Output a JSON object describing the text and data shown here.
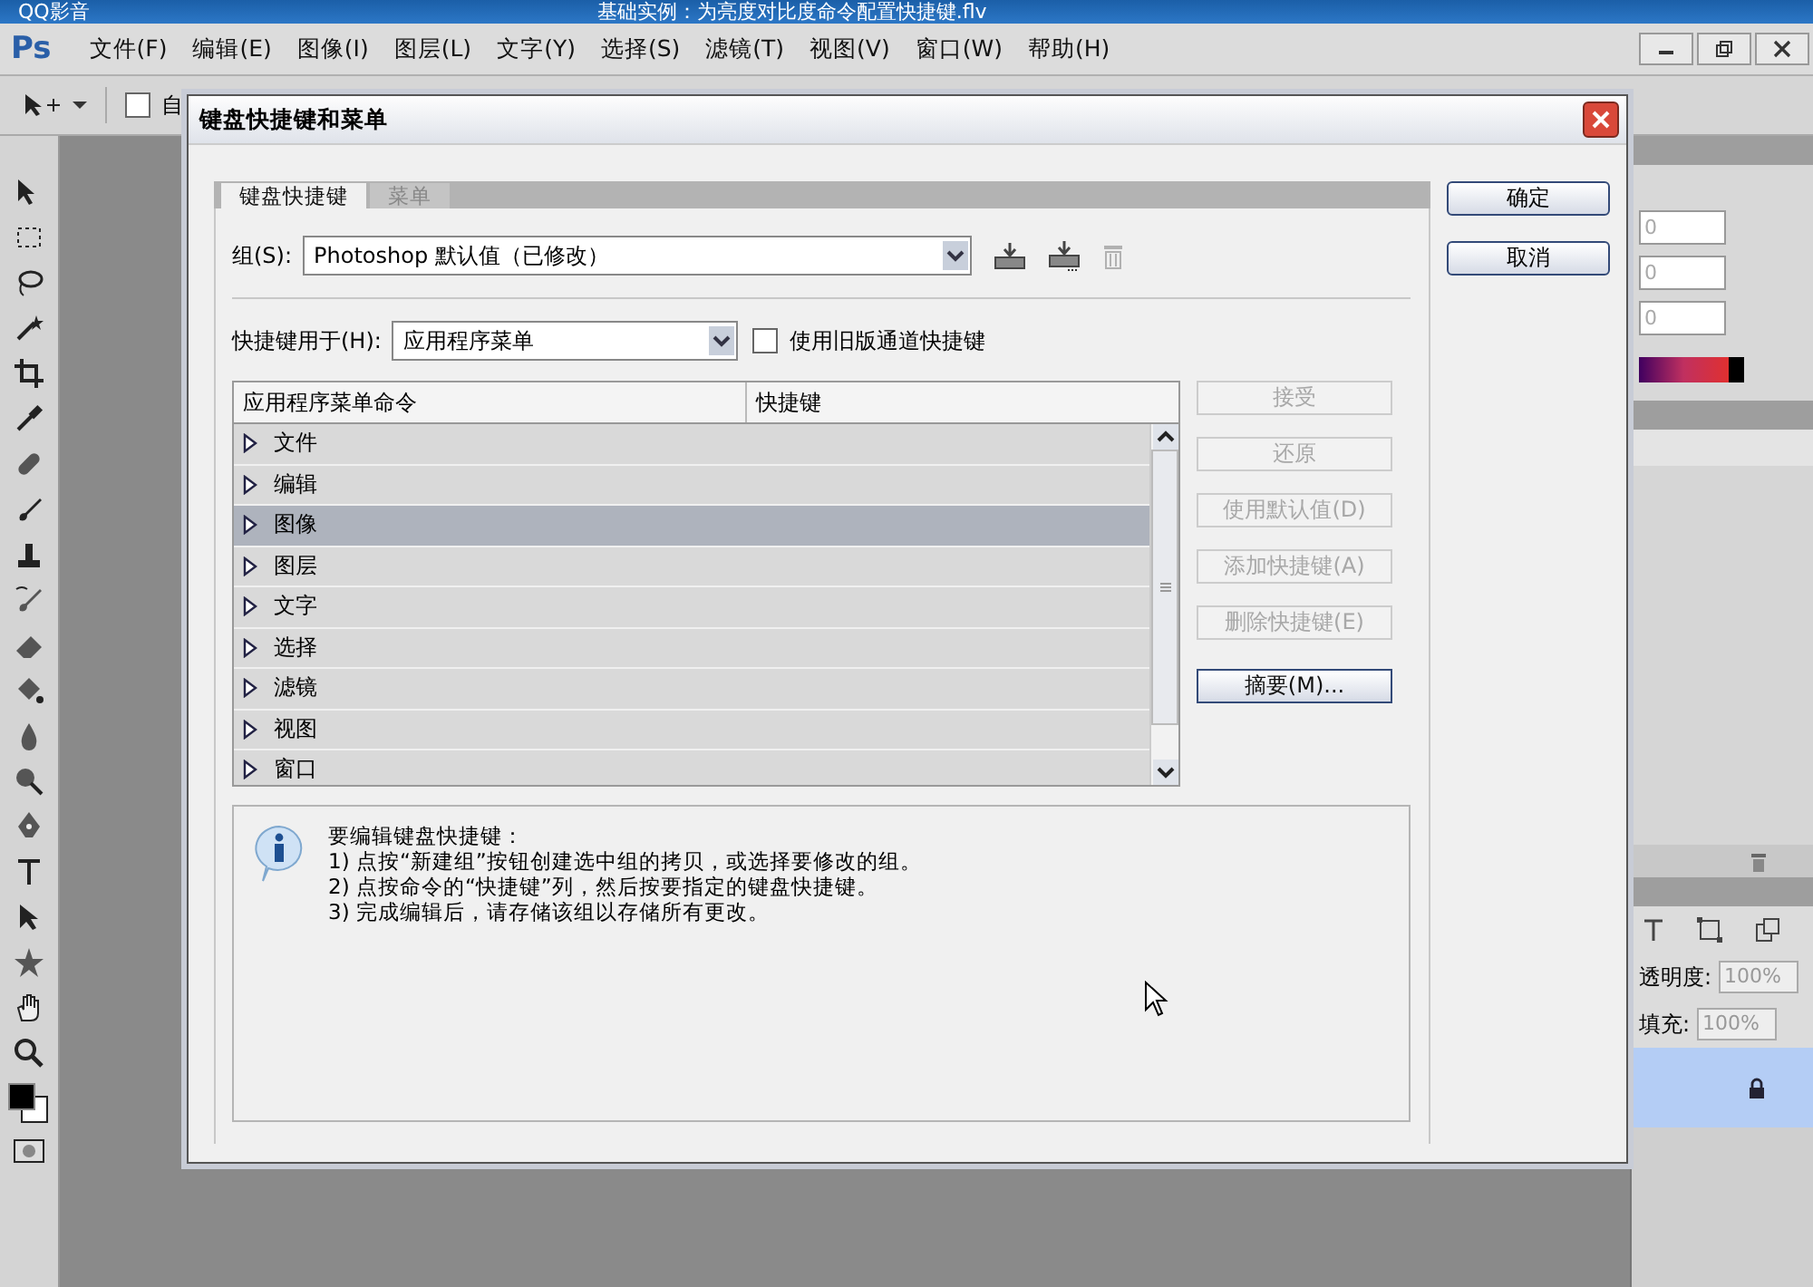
{
  "player_title_bar": {
    "app_name": "QQ影音",
    "video_title": "基础实例：为亮度对比度命令配置快捷键.flv"
  },
  "menu_bar": {
    "logo": "Ps",
    "items": [
      "文件(F)",
      "编辑(E)",
      "图像(I)",
      "图层(L)",
      "文字(Y)",
      "选择(S)",
      "滤镜(T)",
      "视图(V)",
      "窗口(W)",
      "帮助(H)"
    ]
  },
  "options_bar": {
    "checkbox_label": "自",
    "checked": false
  },
  "dialog": {
    "title": "键盘快捷键和菜单",
    "tabs": [
      {
        "label": "键盘快捷键",
        "selected": true
      },
      {
        "label": "菜单",
        "selected": false
      }
    ],
    "set_label": "组(S):",
    "set_value": "Photoshop 默认值（已修改）",
    "delete_disabled": true,
    "shortcuts_for_label": "快捷键用于(H):",
    "shortcuts_for_value": "应用程序菜单",
    "legacy_checkbox": {
      "label": "使用旧版通道快捷键",
      "checked": false
    },
    "table": {
      "columns": [
        "应用程序菜单命令",
        "快捷键"
      ],
      "rows": [
        {
          "label": "文件",
          "selected": false
        },
        {
          "label": "编辑",
          "selected": false
        },
        {
          "label": "图像",
          "selected": true
        },
        {
          "label": "图层",
          "selected": false
        },
        {
          "label": "文字",
          "selected": false
        },
        {
          "label": "选择",
          "selected": false
        },
        {
          "label": "滤镜",
          "selected": false
        },
        {
          "label": "视图",
          "selected": false
        },
        {
          "label": "窗口",
          "selected": false
        }
      ]
    },
    "side_buttons": [
      {
        "label": "接受",
        "disabled": true
      },
      {
        "label": "还原",
        "disabled": true
      },
      {
        "label": "使用默认值(D)",
        "disabled": true
      },
      {
        "label": "添加快捷键(A)",
        "disabled": true
      },
      {
        "label": "删除快捷键(E)",
        "disabled": true
      },
      {
        "label": "摘要(M)...",
        "disabled": false
      }
    ],
    "info_lines": [
      "要编辑键盘快捷键：",
      "1) 点按“新建组”按钮创建选中组的拷贝，或选择要修改的组。",
      "2) 点按命令的“快捷键”列，然后按要指定的键盘快捷键。",
      "3) 完成编辑后，请存储该组以存储所有更改。"
    ],
    "buttons": [
      "确定",
      "取消"
    ]
  },
  "right_panel": {
    "color_values": [
      "0",
      "0",
      "0"
    ],
    "opacity_label": "透明度:",
    "opacity_value": "100%",
    "fill_label": "填充:",
    "fill_value": "100%"
  }
}
